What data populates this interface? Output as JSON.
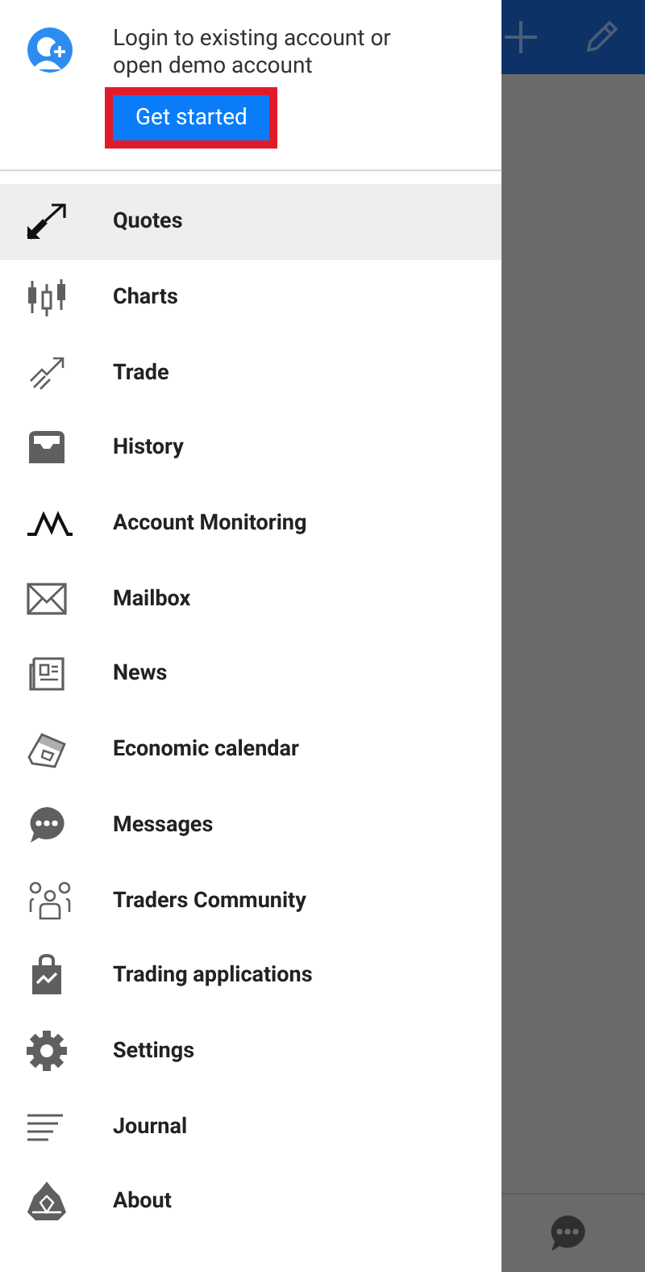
{
  "account": {
    "prompt": "Login to existing account or open demo account",
    "button": {
      "label": "Get started",
      "highlighted": true
    }
  },
  "menu": [
    {
      "label": "Quotes",
      "selected": true
    },
    {
      "label": "Charts",
      "selected": false
    },
    {
      "label": "Trade",
      "selected": false
    },
    {
      "label": "History",
      "selected": false
    },
    {
      "label": "Account Monitoring",
      "selected": false
    },
    {
      "label": "Mailbox",
      "selected": false
    },
    {
      "label": "News",
      "selected": false
    },
    {
      "label": "Economic calendar",
      "selected": false
    },
    {
      "label": "Messages",
      "selected": false
    },
    {
      "label": "Traders Community",
      "selected": false
    },
    {
      "label": "Trading applications",
      "selected": false
    },
    {
      "label": "Settings",
      "selected": false
    },
    {
      "label": "Journal",
      "selected": false
    },
    {
      "label": "About",
      "selected": false
    }
  ]
}
